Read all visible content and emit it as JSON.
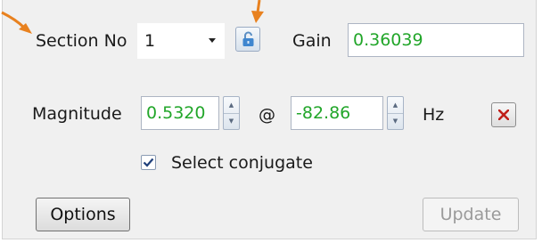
{
  "section": {
    "label": "Section No",
    "value": "1",
    "dropdown_icon": "caret-down-icon"
  },
  "lock": {
    "icon": "lock-icon"
  },
  "gain": {
    "label": "Gain",
    "value": "0.36039"
  },
  "magnitude": {
    "label": "Magnitude",
    "value": "0.5320"
  },
  "at_label": "@",
  "frequency": {
    "value": "-82.86",
    "unit": "Hz"
  },
  "remove": {
    "icon": "close-icon"
  },
  "conjugate": {
    "label": "Select conjugate",
    "checked": true
  },
  "buttons": {
    "options": "Options",
    "update": "Update"
  },
  "annotations": {
    "arrow_color": "#e8811f"
  },
  "colors": {
    "value_text": "#22a62a",
    "panel_bg": "#f0f0f0",
    "close_red": "#c0201a"
  }
}
